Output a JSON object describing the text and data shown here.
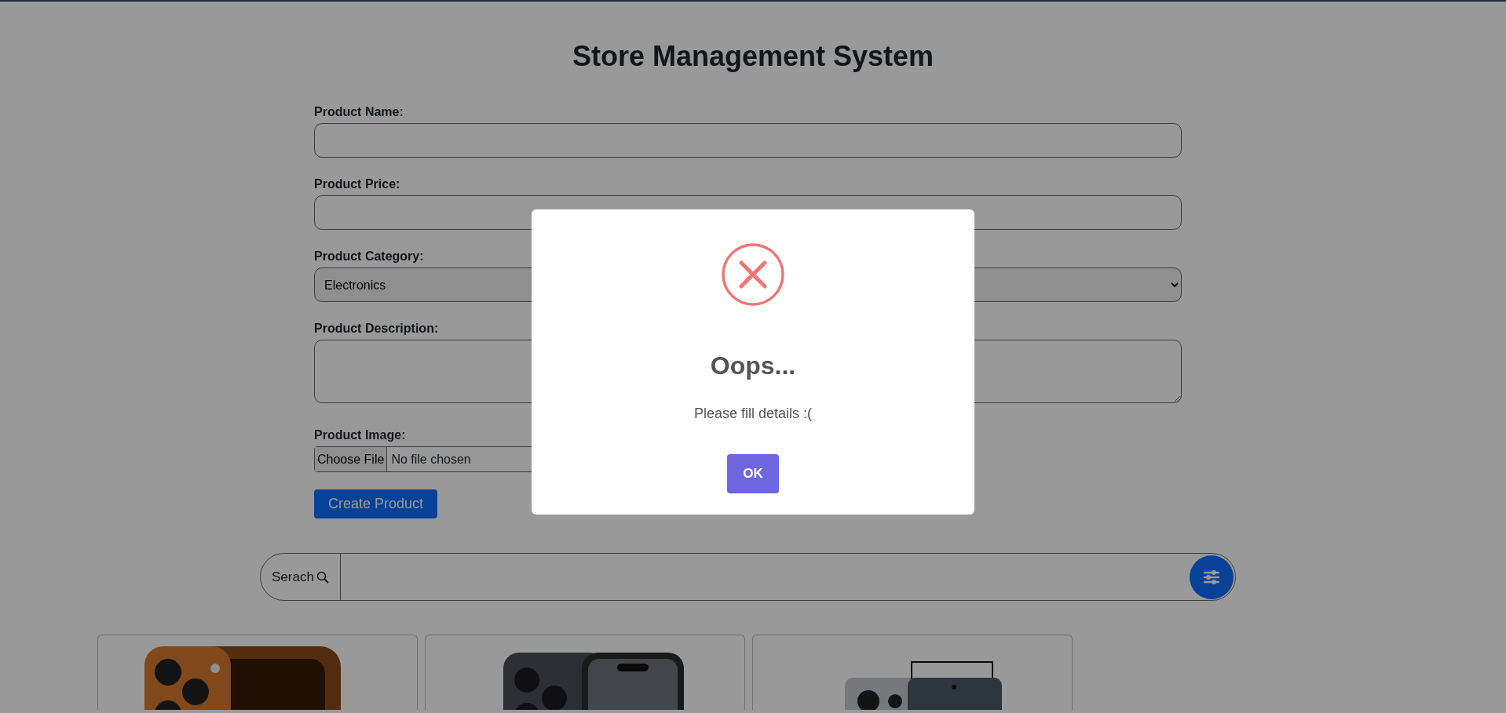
{
  "title": "Store Management System",
  "form": {
    "fields": [
      {
        "kind": "text",
        "label": "Product Name:"
      },
      {
        "kind": "text",
        "label": "Product Price:"
      },
      {
        "kind": "select",
        "label": "Product Category:",
        "value": "Electronics"
      },
      {
        "kind": "textarea",
        "label": "Product Description:"
      },
      {
        "kind": "file",
        "label": "Product Image:",
        "button": "Choose File",
        "value": "No file chosen"
      }
    ],
    "submit": "Create Product"
  },
  "search": {
    "label": "Serach"
  },
  "dialog": {
    "title": "Oops...",
    "message": "Please fill details :(",
    "button": "OK"
  }
}
